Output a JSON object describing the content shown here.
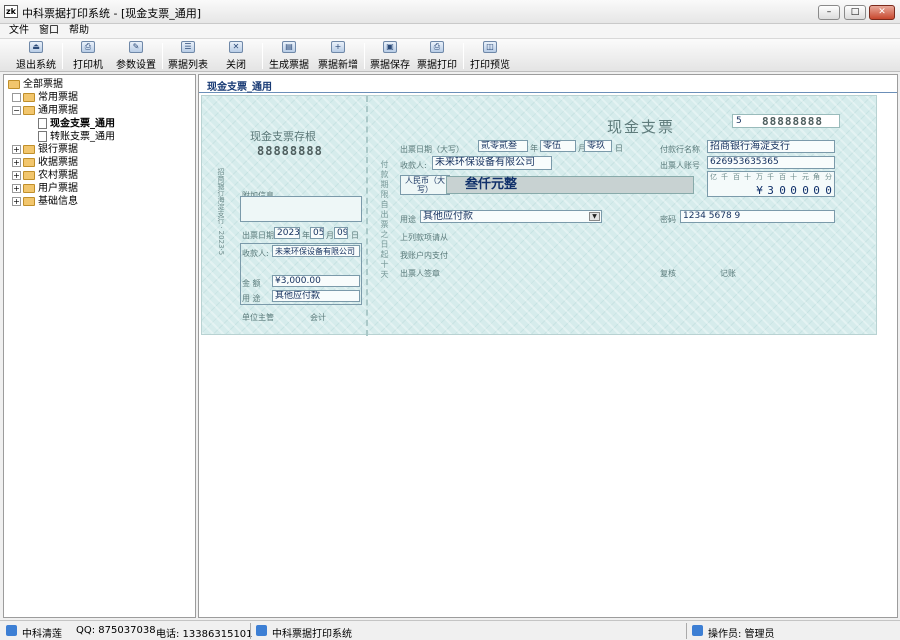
{
  "window": {
    "title": "中科票据打印系统 - [现金支票_通用]",
    "app_icon": "zk-logo-icon",
    "controls": {
      "minimize": "–",
      "maximize": "□",
      "close": "✕"
    }
  },
  "menu": [
    "文件",
    "窗口",
    "帮助"
  ],
  "toolbar": [
    {
      "label": "退出系统",
      "icon": "exit-icon",
      "glyph": "⏏"
    },
    {
      "label": "打印机",
      "icon": "printer-icon",
      "glyph": "⎙"
    },
    {
      "label": "参数设置",
      "icon": "settings-icon",
      "glyph": "✎"
    },
    {
      "label": "票据列表",
      "icon": "list-icon",
      "glyph": "☰"
    },
    {
      "label": "关闭",
      "icon": "close-icon",
      "glyph": "✕"
    },
    {
      "label": "生成票据",
      "icon": "generate-icon",
      "glyph": "▤"
    },
    {
      "label": "票据新增",
      "icon": "new-icon",
      "glyph": "+"
    },
    {
      "label": "票据保存",
      "icon": "save-icon",
      "glyph": "▣"
    },
    {
      "label": "票据打印",
      "icon": "print-icon",
      "glyph": "⎙"
    },
    {
      "label": "打印预览",
      "icon": "preview-icon",
      "glyph": "◫"
    }
  ],
  "tree": {
    "root": "全部票据",
    "common": "常用票据",
    "general": "通用票据",
    "cash_cheque": "现金支票_通用",
    "transfer_cheque": "转账支票_通用",
    "bank": "银行票据",
    "receipt": "收据票据",
    "rural": "农村票据",
    "user": "用户票据",
    "basic": "基础信息"
  },
  "tab": {
    "label": "现金支票_通用"
  },
  "cheque": {
    "stub": {
      "title": "现金支票存根",
      "number": "88888888",
      "vertical_bank": "招商银行海淀支行 ·  2023·5",
      "extra_info_label": "附加信息",
      "issue_date_label": "出票日期",
      "year": "2023",
      "year_unit": "年",
      "month": "05",
      "month_unit": "月",
      "day": "09",
      "day_unit": "日",
      "payee_label": "收款人:",
      "payee": "未来环保设备有限公司",
      "amount_label": "金  额",
      "amount": "¥3,000.00",
      "purpose_label": "用  途",
      "purpose": "其他应付款",
      "supervisor_label": "单位主管",
      "accountant_label": "会计"
    },
    "body": {
      "title": "现金支票",
      "prefix_digit": "5",
      "number": "88888888",
      "date_label": "出票日期（大写）",
      "year_words": "贰零贰叁",
      "year_unit": "年",
      "month_words": "零伍",
      "month_unit": "月",
      "day_words": "零玖",
      "day_unit": "日",
      "bank_label": "付款行名称",
      "bank": "招商银行海淀支行",
      "payee_label": "收款人:",
      "payee": "未来环保设备有限公司",
      "account_label": "出票人账号",
      "account": "626953635365",
      "currency_label": "人民币（大写）",
      "amount_words": "叁仟元整",
      "grid_units": [
        "亿",
        "千",
        "百",
        "十",
        "万",
        "千",
        "百",
        "十",
        "元",
        "角",
        "分"
      ],
      "grid_digits": [
        "",
        "",
        "",
        "",
        "¥",
        "3",
        "0",
        "0",
        "0",
        "0",
        "0"
      ],
      "purpose_label": "用途",
      "purpose": "其他应付款",
      "password_label": "密码",
      "password": "1234 5678 9",
      "line1": "上列款项请从",
      "line2": "我账户内支付",
      "drawer_label": "出票人签章",
      "review_label": "复核",
      "bookkeeper_label": "记账",
      "vertical_notice": "付款期限自出票之日起十天"
    }
  },
  "status": {
    "company": "中科清莲",
    "qq": "QQ: 875037038",
    "phone": "电话: 13386315101",
    "system": "中科票据打印系统",
    "operator": "操作员: 管理员"
  }
}
